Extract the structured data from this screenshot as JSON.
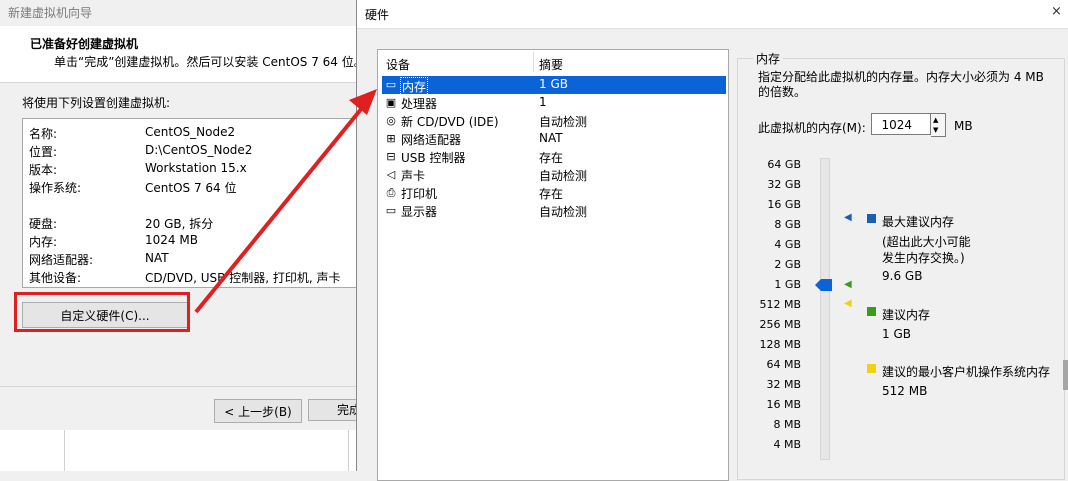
{
  "wizard": {
    "title": "新建虚拟机向导",
    "heading": "已准备好创建虚拟机",
    "subheading": "单击“完成”创建虚拟机。然后可以安装 CentOS 7 64 位。",
    "settings_label": "将使用下列设置创建虚拟机:",
    "settings": [
      {
        "key": "名称:",
        "value": "CentOS_Node2"
      },
      {
        "key": "位置:",
        "value": "D:\\CentOS_Node2"
      },
      {
        "key": "版本:",
        "value": "Workstation 15.x"
      },
      {
        "key": "操作系统:",
        "value": "CentOS 7 64 位"
      },
      {
        "key": "硬盘:",
        "value": "20 GB, 拆分"
      },
      {
        "key": "内存:",
        "value": "1024 MB"
      },
      {
        "key": "网络适配器:",
        "value": "NAT"
      },
      {
        "key": "其他设备:",
        "value": "CD/DVD, USB 控制器, 打印机, 声卡"
      }
    ],
    "customize_button": "自定义硬件(C)...",
    "back_button": "< 上一步(B)",
    "finish_button": "完成"
  },
  "hardware": {
    "title": "硬件",
    "close_glyph": "×",
    "columns": {
      "device": "设备",
      "summary": "摘要"
    },
    "devices": [
      {
        "icon": "memory-icon",
        "glyph": "▭",
        "name": "内存",
        "summary": "1 GB",
        "selected": true
      },
      {
        "icon": "processor-icon",
        "glyph": "▣",
        "name": "处理器",
        "summary": "1"
      },
      {
        "icon": "cd-dvd-icon",
        "glyph": "◎",
        "name": "新 CD/DVD (IDE)",
        "summary": "自动检测"
      },
      {
        "icon": "network-adapter-icon",
        "glyph": "⊞",
        "name": "网络适配器",
        "summary": "NAT"
      },
      {
        "icon": "usb-controller-icon",
        "glyph": "⊟",
        "name": "USB 控制器",
        "summary": "存在"
      },
      {
        "icon": "sound-card-icon",
        "glyph": "◁",
        "name": "声卡",
        "summary": "自动检测"
      },
      {
        "icon": "printer-icon",
        "glyph": "⎙",
        "name": "打印机",
        "summary": "存在"
      },
      {
        "icon": "display-icon",
        "glyph": "▭",
        "name": "显示器",
        "summary": "自动检测"
      }
    ],
    "memory": {
      "section_title": "内存",
      "description": "指定分配给此虚拟机的内存量。内存大小必须为 4 MB 的倍数。",
      "field_label": "此虚拟机的内存(M):",
      "value": "1024",
      "unit": "MB",
      "scale_ticks": [
        "64 GB",
        "32 GB",
        "16 GB",
        "8 GB",
        "4 GB",
        "2 GB",
        "1 GB",
        "512 MB",
        "256 MB",
        "128 MB",
        "64 MB",
        "32 MB",
        "16 MB",
        "8 MB",
        "4 MB"
      ],
      "legend": {
        "max_recommended": {
          "title": "最大建议内存",
          "note": "(超出此大小可能\n发生内存交换。)",
          "value": "9.6 GB",
          "color": "#1a5fb4"
        },
        "recommended": {
          "title": "建议内存",
          "value": "1 GB",
          "color": "#3c9a1e"
        },
        "min_guest": {
          "title": "建议的最小客户机操作系统内存",
          "value": "512 MB",
          "color": "#f2d20a"
        }
      },
      "slider_value": "1 GB"
    }
  },
  "colors": {
    "highlight": "#e02020",
    "selection": "#0a64d8"
  }
}
